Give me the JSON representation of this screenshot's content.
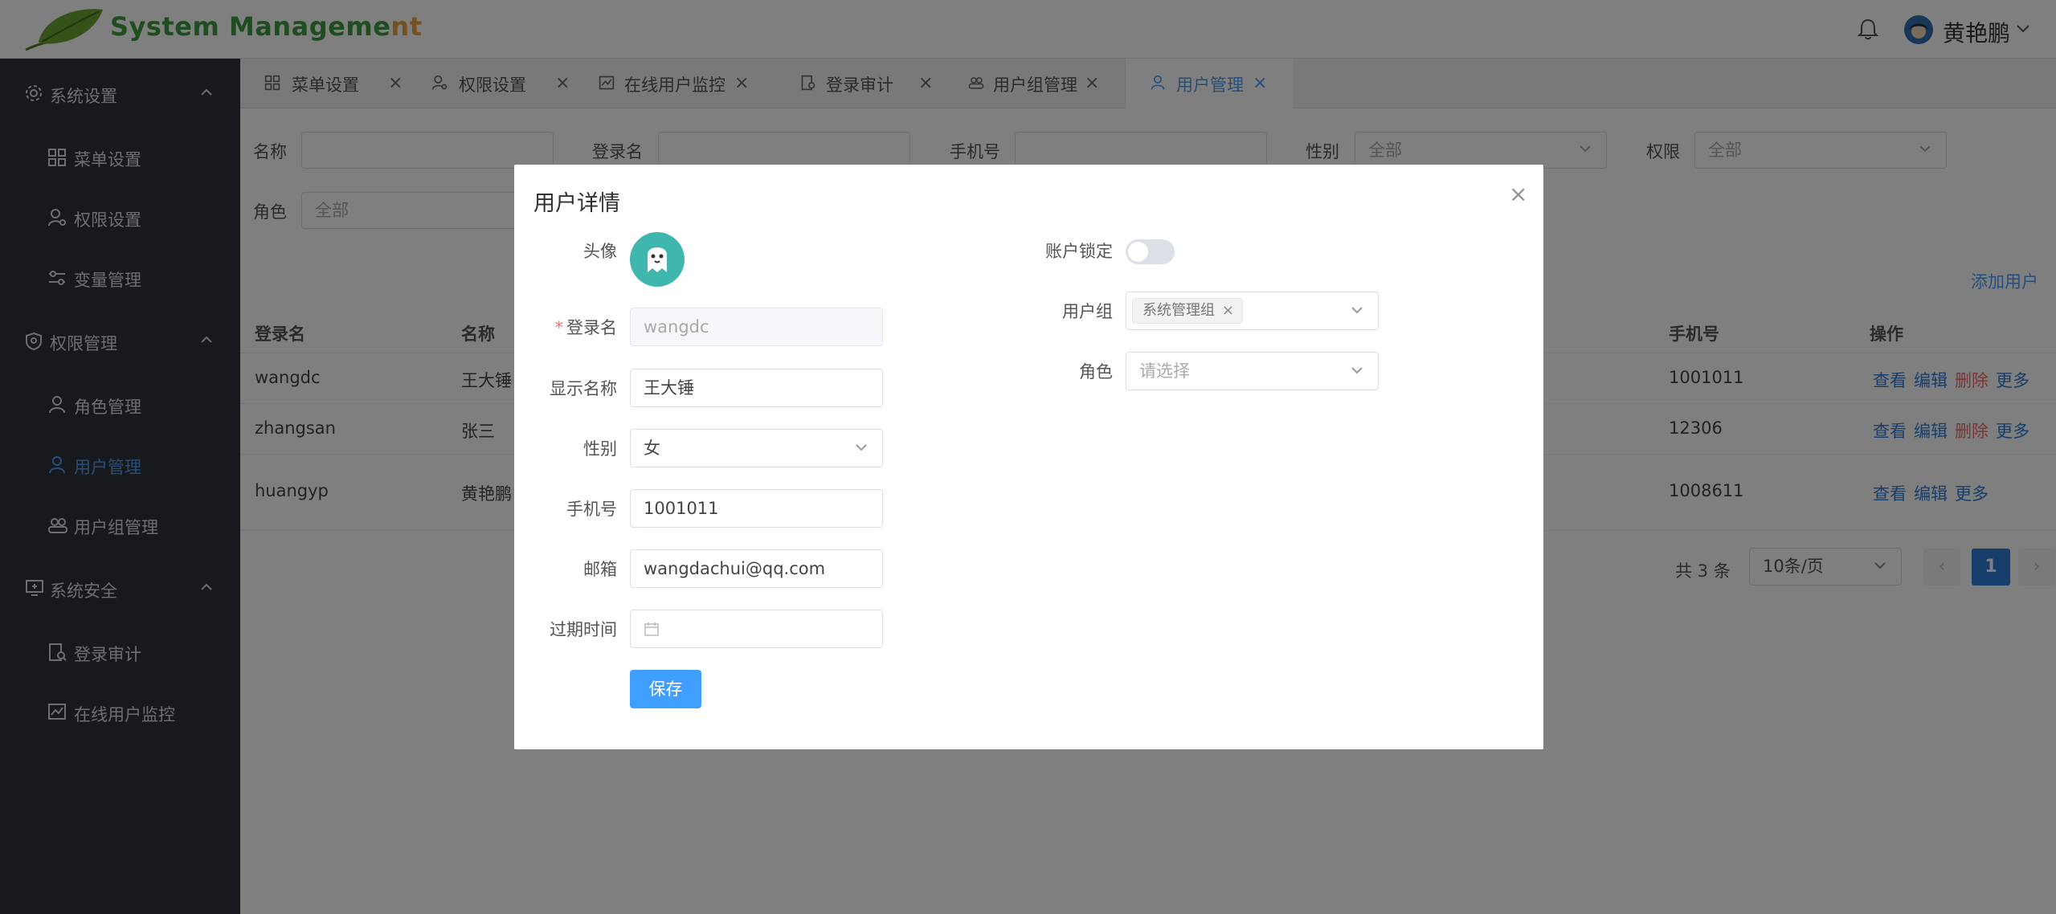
{
  "header": {
    "app_title_main": "System Manageme",
    "app_title_tail": "nt",
    "user_name": "黄艳鹏"
  },
  "sidebar": {
    "groups": [
      {
        "label": "系统设置",
        "icon": "gear-icon"
      },
      {
        "label": "权限管理",
        "icon": "shield-icon"
      },
      {
        "label": "系统安全",
        "icon": "monitor-icon"
      }
    ],
    "items": [
      {
        "label": "菜单设置",
        "icon": "grid-icon"
      },
      {
        "label": "权限设置",
        "icon": "user-key-icon"
      },
      {
        "label": "变量管理",
        "icon": "sliders-icon"
      },
      {
        "label": "角色管理",
        "icon": "user-icon"
      },
      {
        "label": "用户管理",
        "icon": "user-icon",
        "active": true
      },
      {
        "label": "用户组管理",
        "icon": "users-icon"
      },
      {
        "label": "登录审计",
        "icon": "audit-icon"
      },
      {
        "label": "在线用户监控",
        "icon": "chart-icon"
      }
    ]
  },
  "tabs": [
    {
      "label": "菜单设置"
    },
    {
      "label": "权限设置"
    },
    {
      "label": "在线用户监控"
    },
    {
      "label": "登录审计"
    },
    {
      "label": "用户组管理"
    },
    {
      "label": "用户管理",
      "active": true
    }
  ],
  "filters": {
    "name_label": "名称",
    "login_label": "登录名",
    "phone_label": "手机号",
    "gender_label": "性别",
    "gender_value": "全部",
    "perm_label": "权限",
    "perm_value": "全部",
    "role_label": "角色",
    "role_value": "全部"
  },
  "add_link": "添加用户",
  "table": {
    "columns": [
      "登录名",
      "名称",
      "手机号",
      "操作"
    ],
    "rows": [
      {
        "login": "wangdc",
        "name": "王大锤",
        "phone": "1001011",
        "ops": [
          "查看",
          "编辑",
          "删除",
          "更多"
        ]
      },
      {
        "login": "zhangsan",
        "name": "张三",
        "phone": "12306",
        "ops": [
          "查看",
          "编辑",
          "删除",
          "更多"
        ]
      },
      {
        "login": "huangyp",
        "name": "黄艳鹏",
        "phone": "1008611",
        "ops": [
          "查看",
          "编辑",
          "更多"
        ]
      }
    ]
  },
  "pagination": {
    "total": "共 3 条",
    "page_size": "10条/页",
    "current_page": "1",
    "prev": "‹",
    "next": "›"
  },
  "dialog": {
    "title": "用户详情",
    "close": "×",
    "required_mark": "*",
    "fields": {
      "avatar_label": "头像",
      "login_label": "登录名",
      "login_value": "wangdc",
      "display_label": "显示名称",
      "display_value": "王大锤",
      "gender_label": "性别",
      "gender_value": "女",
      "phone_label": "手机号",
      "phone_value": "1001011",
      "email_label": "邮箱",
      "email_value": "wangdachui@qq.com",
      "expire_label": "过期时间",
      "expire_value": ""
    },
    "right": {
      "lock_label": "账户锁定",
      "lock_on": false,
      "group_label": "用户组",
      "group_tag": "系统管理组",
      "role_label": "角色",
      "role_placeholder": "请选择"
    },
    "save_label": "保存"
  }
}
